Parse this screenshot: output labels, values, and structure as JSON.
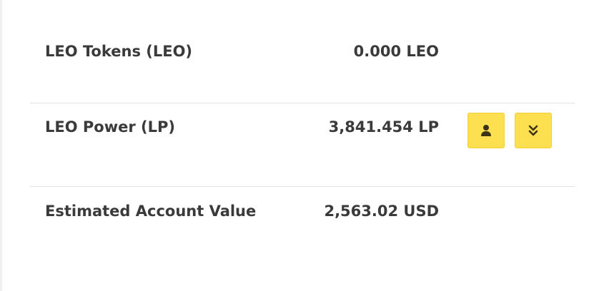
{
  "balances": {
    "leo_tokens": {
      "label": "LEO Tokens (LEO)",
      "value": "0.000 LEO"
    },
    "leo_power": {
      "label": "LEO Power (LP)",
      "value": "3,841.454 LP",
      "actions": [
        {
          "name": "delegate",
          "icon": "user-icon"
        },
        {
          "name": "power-down",
          "icon": "double-chevron-down-icon"
        }
      ]
    },
    "estimated_value": {
      "label": "Estimated Account Value",
      "value": "2,563.02 USD"
    }
  },
  "colors": {
    "button_bg": "#fde050",
    "icon": "#3d3416",
    "text": "#3a3a3a",
    "divider": "#e3e3e3"
  }
}
